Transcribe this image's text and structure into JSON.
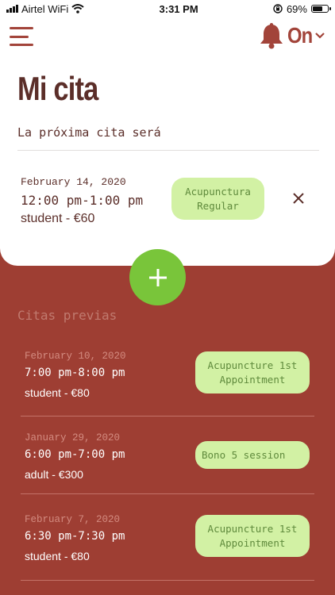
{
  "status": {
    "carrier": "Airtel WiFi",
    "time": "3:31 PM",
    "battery": "69%",
    "battery_level": 0.69
  },
  "header": {
    "notifications_label": "On",
    "title": "Mi cita",
    "subtitle": "La próxima cita será"
  },
  "next_appointment": {
    "date": "February 14, 2020",
    "time": "12:00 pm-1:00 pm",
    "price": "student - €60",
    "treatment": "Acupunctura Regular"
  },
  "previous": {
    "title": "Citas previas",
    "items": [
      {
        "date": "February 10, 2020",
        "time": "7:00 pm-8:00 pm",
        "price": "student - €80",
        "treatment": "Acupuncture 1st Appointment"
      },
      {
        "date": "January 29, 2020",
        "time": "6:00 pm-7:00 pm",
        "price": "adult - €300",
        "treatment": "Bono 5 session"
      },
      {
        "date": "February 7, 2020",
        "time": "6:30 pm-7:30 pm",
        "price": "student - €80",
        "treatment": "Acupuncture 1st Appointment"
      }
    ]
  },
  "colors": {
    "brand": "#a2443a",
    "background": "#9e3e33",
    "accent": "#79c53a",
    "tag_bg": "#d2f1a4"
  }
}
